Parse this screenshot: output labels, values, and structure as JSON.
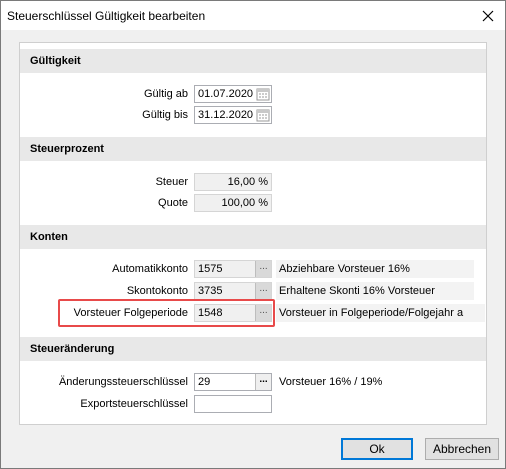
{
  "window": {
    "title": "Steuerschlüssel Gültigkeit bearbeiten"
  },
  "sections": {
    "validity": {
      "header": "Gültigkeit",
      "valid_from_label": "Gültig ab",
      "valid_from_value": "01.07.2020",
      "valid_to_label": "Gültig bis",
      "valid_to_value": "31.12.2020"
    },
    "tax_percent": {
      "header": "Steuerprozent",
      "tax_label": "Steuer",
      "tax_value": "16,00 %",
      "quota_label": "Quote",
      "quota_value": "100,00 %"
    },
    "accounts": {
      "header": "Konten",
      "auto_label": "Automatikkonto",
      "auto_value": "1575",
      "auto_desc": "Abziehbare Vorsteuer 16%",
      "skonto_label": "Skontokonto",
      "skonto_value": "3735",
      "skonto_desc": "Erhaltene Skonti 16% Vorsteuer",
      "next_period_label": "Vorsteuer Folgeperiode",
      "next_period_value": "1548",
      "next_period_desc": "Vorsteuer in Folgeperiode/Folgejahr a"
    },
    "tax_change": {
      "header": "Steueränderung",
      "change_key_label": "Änderungssteuerschlüssel",
      "change_key_value": "29",
      "change_key_desc": "Vorsteuer 16% / 19%",
      "export_key_label": "Exportsteuerschlüssel",
      "export_key_value": ""
    }
  },
  "lookup_glyph": "...",
  "buttons": {
    "ok": "Ok",
    "cancel": "Abbrechen"
  },
  "icons": {
    "close": "close-icon",
    "calendar": "calendar-icon"
  },
  "colors": {
    "highlight": "#e84a4a",
    "default_button_border": "#0078d7"
  }
}
